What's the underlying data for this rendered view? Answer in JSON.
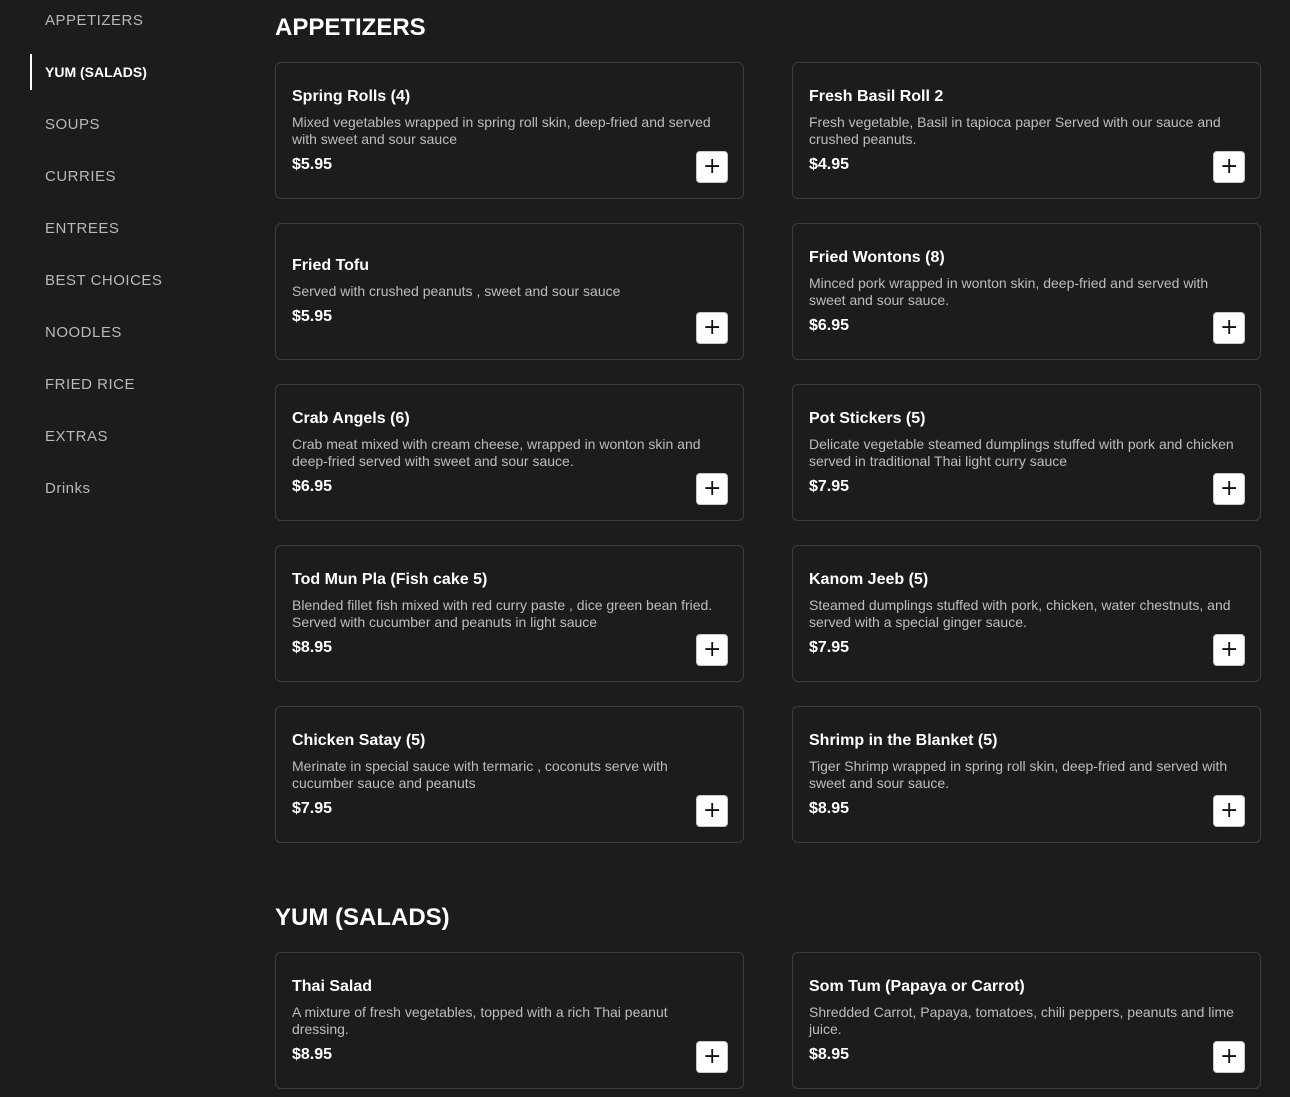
{
  "sidebar": {
    "items": [
      {
        "label": "APPETIZERS",
        "active": false
      },
      {
        "label": "YUM (SALADS)",
        "active": true
      },
      {
        "label": "SOUPS",
        "active": false
      },
      {
        "label": "CURRIES",
        "active": false
      },
      {
        "label": "ENTREES",
        "active": false
      },
      {
        "label": "BEST CHOICES",
        "active": false
      },
      {
        "label": "NOODLES",
        "active": false
      },
      {
        "label": "FRIED RICE",
        "active": false
      },
      {
        "label": "EXTRAS",
        "active": false
      },
      {
        "label": "Drinks",
        "active": false
      }
    ]
  },
  "icons": {
    "add": "plus-icon"
  },
  "colors": {
    "background": "#1c1c1c",
    "card_border": "#3d3d3d",
    "button": "#ffffff"
  },
  "sections": [
    {
      "title": "APPETIZERS",
      "items": [
        {
          "name": "Spring Rolls (4)",
          "description": "Mixed vegetables wrapped in spring roll skin, deep-fried and served with sweet and sour sauce",
          "price": "$5.95",
          "add_label": "+"
        },
        {
          "name": "Fresh Basil Roll 2",
          "description": "Fresh vegetable, Basil in tapioca paper Served with our sauce and crushed peanuts.",
          "price": "$4.95",
          "add_label": "+"
        },
        {
          "name": "Fried Tofu",
          "description": "Served with crushed peanuts , sweet and sour sauce",
          "price": "$5.95",
          "add_label": "+"
        },
        {
          "name": "Fried Wontons (8)",
          "description": "Minced pork wrapped in wonton skin, deep-fried and served with sweet and sour sauce.",
          "price": "$6.95",
          "add_label": "+"
        },
        {
          "name": "Crab Angels (6)",
          "description": "Crab meat mixed with cream cheese, wrapped in wonton skin and deep-fried served with sweet and sour sauce.",
          "price": "$6.95",
          "add_label": "+"
        },
        {
          "name": "Pot Stickers (5)",
          "description": "Delicate vegetable steamed dumplings stuffed with pork and chicken served in traditional Thai light curry sauce",
          "price": "$7.95",
          "add_label": "+"
        },
        {
          "name": "Tod Mun Pla (Fish cake 5)",
          "description": "Blended fillet fish mixed with red curry paste , dice green bean fried. Served with cucumber and peanuts in light sauce",
          "price": "$8.95",
          "add_label": "+"
        },
        {
          "name": "Kanom Jeeb (5)",
          "description": "Steamed dumplings stuffed with pork, chicken, water chestnuts, and served with a special ginger sauce.",
          "price": "$7.95",
          "add_label": "+"
        },
        {
          "name": "Chicken Satay (5)",
          "description": "Merinate in special sauce with termaric , coconuts serve with cucumber sauce and peanuts",
          "price": "$7.95",
          "add_label": "+"
        },
        {
          "name": "Shrimp in the Blanket (5)",
          "description": "Tiger Shrimp wrapped in spring roll skin, deep-fried and served with sweet and sour sauce.",
          "price": "$8.95",
          "add_label": "+"
        }
      ]
    },
    {
      "title": "YUM (SALADS)",
      "items": [
        {
          "name": "Thai Salad",
          "description": "A mixture of fresh vegetables, topped with a rich Thai peanut dressing.",
          "price": "$8.95",
          "add_label": "+"
        },
        {
          "name": "Som Tum (Papaya or Carrot)",
          "description": "Shredded Carrot, Papaya, tomatoes, chili peppers, peanuts and lime juice.",
          "price": "$8.95",
          "add_label": "+"
        }
      ]
    }
  ]
}
